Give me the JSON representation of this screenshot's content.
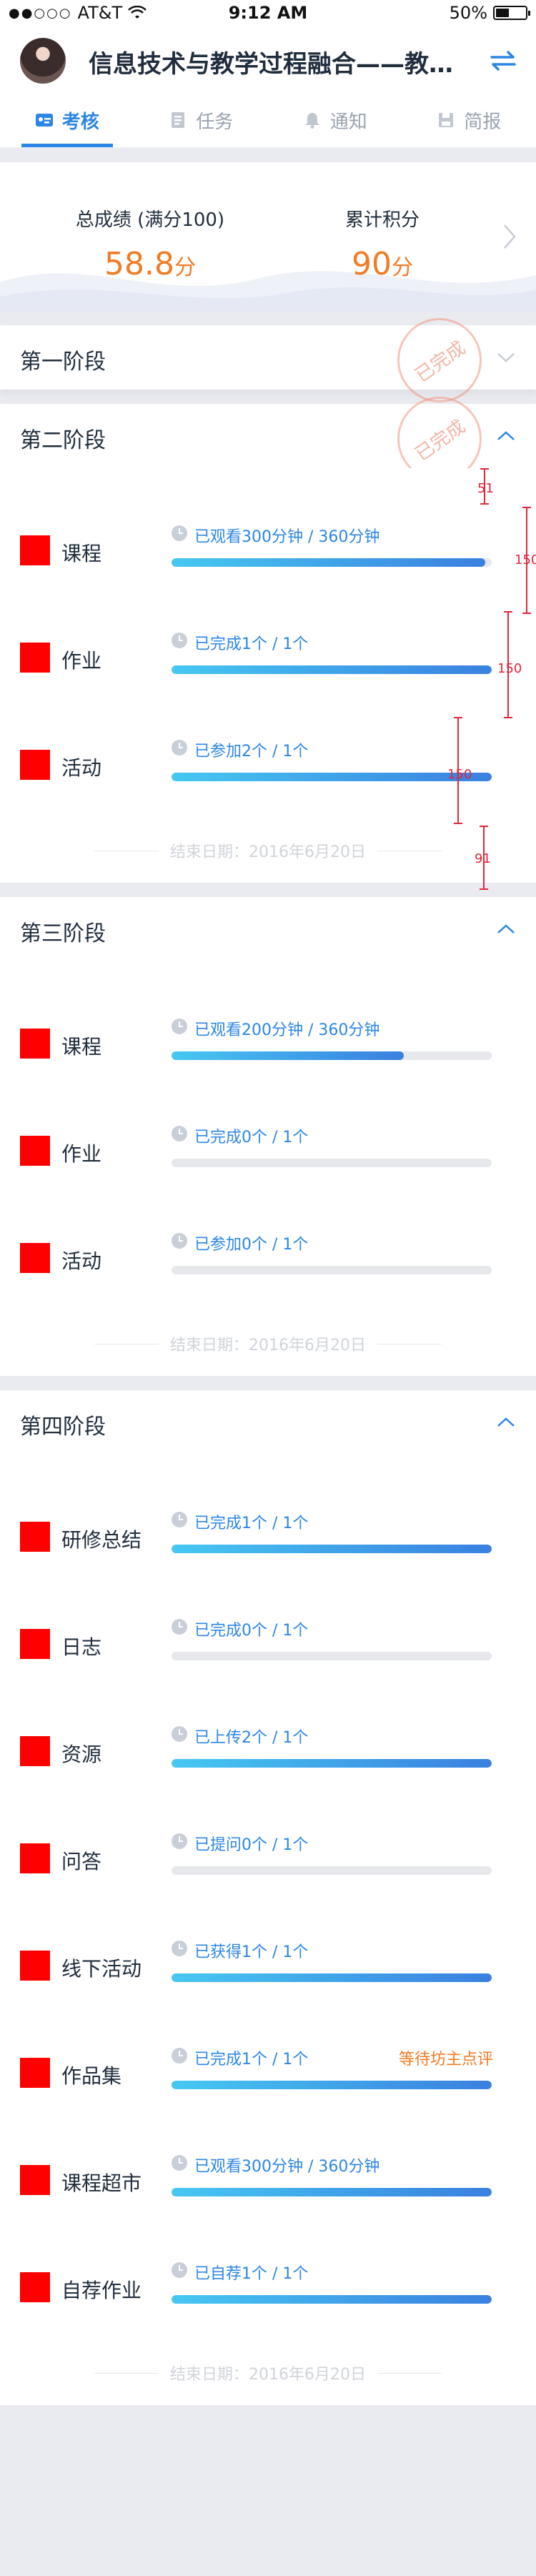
{
  "status": {
    "carrier": "AT&T",
    "time": "9:12 AM",
    "battery": "50%",
    "battery_level": 0.5
  },
  "header": {
    "title": "信息技术与教学过程融合——教..."
  },
  "tabs": [
    {
      "label": "考核",
      "icon": "id-card-icon",
      "active": true
    },
    {
      "label": "任务",
      "icon": "document-icon",
      "active": false
    },
    {
      "label": "通知",
      "icon": "bell-icon",
      "active": false
    },
    {
      "label": "简报",
      "icon": "save-icon",
      "active": false
    }
  ],
  "score": {
    "total_label": "总成绩 (满分100)",
    "total_value": "58.8",
    "total_unit": "分",
    "points_label": "累计积分",
    "points_value": "90",
    "points_unit": "分"
  },
  "stages": [
    {
      "title": "第一阶段",
      "stamp": "已完成"
    },
    {
      "title": "第二阶段",
      "stamp": "已完成",
      "items": [
        {
          "label": "课程",
          "progress": "已观看300分钟 / 360分钟",
          "fill": 0.98
        },
        {
          "label": "作业",
          "progress": "已完成1个 / 1个",
          "fill": 1.0
        },
        {
          "label": "活动",
          "progress": "已参加2个 / 1个",
          "fill": 1.0
        }
      ],
      "end_date": "结束日期：2016年6月20日"
    },
    {
      "title": "第三阶段",
      "items": [
        {
          "label": "课程",
          "progress": "已观看200分钟 / 360分钟",
          "fill": 0.725
        },
        {
          "label": "作业",
          "progress": "已完成0个 / 1个",
          "fill": 0
        },
        {
          "label": "活动",
          "progress": "已参加0个 / 1个",
          "fill": 0
        }
      ],
      "end_date": "结束日期：2016年6月20日"
    },
    {
      "title": "第四阶段",
      "items": [
        {
          "label": "研修总结",
          "progress": "已完成1个 / 1个",
          "fill": 1.0
        },
        {
          "label": "日志",
          "progress": "已完成0个 / 1个",
          "fill": 0
        },
        {
          "label": "资源",
          "progress": "已上传2个 / 1个",
          "fill": 1.0
        },
        {
          "label": "问答",
          "progress": "已提问0个 / 1个",
          "fill": 0
        },
        {
          "label": "线下活动",
          "progress": "已获得1个 / 1个",
          "fill": 1.0
        },
        {
          "label": "作品集",
          "progress": "已完成1个 / 1个",
          "fill": 1.0,
          "note": "等待坊主点评"
        },
        {
          "label": "课程超市",
          "progress": "已观看300分钟 / 360分钟",
          "fill": 1.0
        },
        {
          "label": "自荐作业",
          "progress": "已自荐1个 / 1个",
          "fill": 1.0
        }
      ],
      "end_date": "结束日期：2016年6月20日"
    }
  ],
  "measurements": {
    "m1": "51",
    "m2": "150",
    "m3": "150",
    "m4": "150",
    "m5": "91"
  }
}
